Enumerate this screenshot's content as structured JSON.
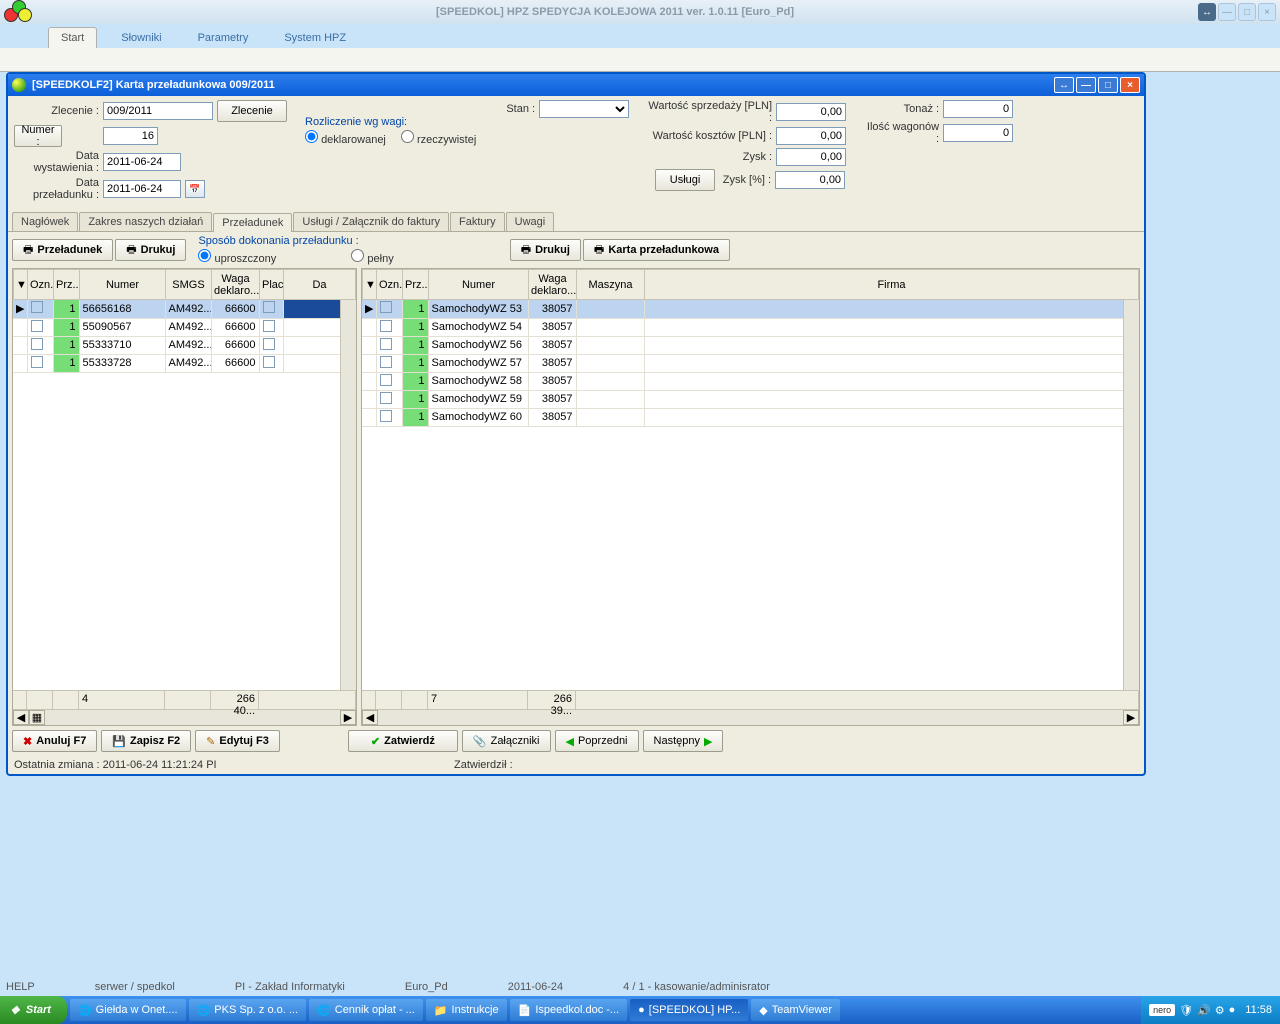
{
  "app": {
    "title": "[SPEEDKOL] HPZ SPEDYCJA KOLEJOWA 2011 ver. 1.0.11 [Euro_Pd]",
    "ribbon_tabs": [
      "Start",
      "Słowniki",
      "Parametry",
      "System HPZ"
    ]
  },
  "mdi": {
    "title": "[SPEEDKOLF2] Karta przeładunkowa 009/2011",
    "form": {
      "zlecenie_lbl": "Zlecenie :",
      "zlecenie_val": "009/2011",
      "zlecenie_btn": "Zlecenie",
      "numer_lbl": "Numer :",
      "numer_val": "16",
      "data_wyst_lbl": "Data wystawienia :",
      "data_wyst_val": "2011-06-24",
      "data_przel_lbl": "Data przeładunku :",
      "data_przel_val": "2011-06-24",
      "stan_lbl": "Stan :",
      "rozl_title": "Rozliczenie wg wagi:",
      "rozl_dekl": "deklarowanej",
      "rozl_rzecz": "rzeczywistej",
      "wart_sprz_lbl": "Wartość sprzedaży [PLN] :",
      "wart_sprz_val": "0,00",
      "wart_koszt_lbl": "Wartość kosztów [PLN] :",
      "wart_koszt_val": "0,00",
      "zysk_lbl": "Zysk :",
      "zysk_val": "0,00",
      "zysk_pct_lbl": "Zysk [%] :",
      "zysk_pct_val": "0,00",
      "tonaz_lbl": "Tonaż :",
      "tonaz_val": "0",
      "ilosc_wag_lbl": "Ilość wagonów :",
      "ilosc_wag_val": "0",
      "uslugi_btn": "Usługi"
    },
    "tabs": [
      "Nagłówek",
      "Zakres naszych działań",
      "Przeładunek",
      "Usługi / Załącznik do faktury",
      "Faktury",
      "Uwagi"
    ],
    "active_tab": 2,
    "przeladunek_btn": "Przeładunek",
    "drukuj_btn": "Drukuj",
    "sposob_title": "Sposób dokonania przeładunku :",
    "sposob_upr": "uproszczony",
    "sposob_pelny": "pełny",
    "drukuj2_btn": "Drukuj",
    "karta_btn": "Karta przeładunkowa",
    "left_headers": {
      "ozn": "Ozn.",
      "prz": "Prz...",
      "numer": "Numer",
      "smgs": "SMGS",
      "waga": "Waga deklaro...",
      "plac": "Plac",
      "da": "Da"
    },
    "left_rows": [
      {
        "prz": "1",
        "numer": "56656168",
        "smgs": "AM492...",
        "waga": "66600"
      },
      {
        "prz": "1",
        "numer": "55090567",
        "smgs": "AM492...",
        "waga": "66600"
      },
      {
        "prz": "1",
        "numer": "55333710",
        "smgs": "AM492...",
        "waga": "66600"
      },
      {
        "prz": "1",
        "numer": "55333728",
        "smgs": "AM492...",
        "waga": "66600"
      }
    ],
    "left_footer": {
      "count": "4",
      "sum": "266 40..."
    },
    "right_headers": {
      "ozn": "Ozn.",
      "prz": "Prz...",
      "numer": "Numer",
      "waga": "Waga deklaro...",
      "maszyna": "Maszyna",
      "firma": "Firma"
    },
    "right_rows": [
      {
        "prz": "1",
        "numer": "SamochodyWZ 53",
        "waga": "38057"
      },
      {
        "prz": "1",
        "numer": "SamochodyWZ 54",
        "waga": "38057"
      },
      {
        "prz": "1",
        "numer": "SamochodyWZ 56",
        "waga": "38057"
      },
      {
        "prz": "1",
        "numer": "SamochodyWZ 57",
        "waga": "38057"
      },
      {
        "prz": "1",
        "numer": "SamochodyWZ 58",
        "waga": "38057"
      },
      {
        "prz": "1",
        "numer": "SamochodyWZ 59",
        "waga": "38057"
      },
      {
        "prz": "1",
        "numer": "SamochodyWZ 60",
        "waga": "38057"
      }
    ],
    "right_footer": {
      "count": "7",
      "sum": "266 39..."
    },
    "bottom": {
      "anuluj": "Anuluj F7",
      "zapisz": "Zapisz F2",
      "edytuj": "Edytuj F3",
      "zatwierdz": "Zatwierdź",
      "zalaczniki": "Załączniki",
      "poprzedni": "Poprzedni",
      "nastepny": "Następny"
    },
    "status": {
      "ostatnia": "Ostatnia zmiana :   2011-06-24 11:21:24     PI",
      "zatwierdzil": "Zatwierdził :"
    }
  },
  "app_status": {
    "help": "HELP",
    "server": "serwer / spedkol",
    "dept": "PI - Zakład Informatyki",
    "db": "Euro_Pd",
    "date": "2011-06-24",
    "perm": "4 / 1 - kasowanie/adminisrator"
  },
  "taskbar": {
    "start": "Start",
    "items": [
      "Giełda w Onet....",
      "PKS Sp. z o.o. ...",
      "Cennik opłat - ...",
      "Instrukcje",
      "Ispeedkol.doc -...",
      "[SPEEDKOL] HP...",
      "TeamViewer"
    ],
    "nero": "nero",
    "clock": "11:58"
  }
}
